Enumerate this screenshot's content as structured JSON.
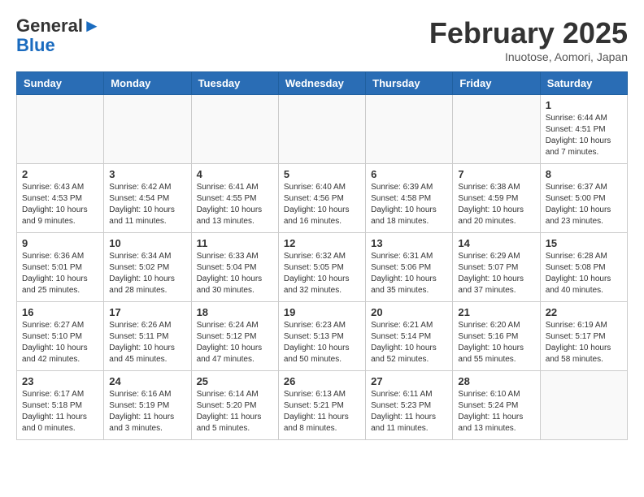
{
  "logo": {
    "general": "General",
    "blue": "Blue"
  },
  "title": "February 2025",
  "subtitle": "Inuotose, Aomori, Japan",
  "days": [
    "Sunday",
    "Monday",
    "Tuesday",
    "Wednesday",
    "Thursday",
    "Friday",
    "Saturday"
  ],
  "weeks": [
    [
      {
        "day": "",
        "info": ""
      },
      {
        "day": "",
        "info": ""
      },
      {
        "day": "",
        "info": ""
      },
      {
        "day": "",
        "info": ""
      },
      {
        "day": "",
        "info": ""
      },
      {
        "day": "",
        "info": ""
      },
      {
        "day": "1",
        "info": "Sunrise: 6:44 AM\nSunset: 4:51 PM\nDaylight: 10 hours\nand 7 minutes."
      }
    ],
    [
      {
        "day": "2",
        "info": "Sunrise: 6:43 AM\nSunset: 4:53 PM\nDaylight: 10 hours\nand 9 minutes."
      },
      {
        "day": "3",
        "info": "Sunrise: 6:42 AM\nSunset: 4:54 PM\nDaylight: 10 hours\nand 11 minutes."
      },
      {
        "day": "4",
        "info": "Sunrise: 6:41 AM\nSunset: 4:55 PM\nDaylight: 10 hours\nand 13 minutes."
      },
      {
        "day": "5",
        "info": "Sunrise: 6:40 AM\nSunset: 4:56 PM\nDaylight: 10 hours\nand 16 minutes."
      },
      {
        "day": "6",
        "info": "Sunrise: 6:39 AM\nSunset: 4:58 PM\nDaylight: 10 hours\nand 18 minutes."
      },
      {
        "day": "7",
        "info": "Sunrise: 6:38 AM\nSunset: 4:59 PM\nDaylight: 10 hours\nand 20 minutes."
      },
      {
        "day": "8",
        "info": "Sunrise: 6:37 AM\nSunset: 5:00 PM\nDaylight: 10 hours\nand 23 minutes."
      }
    ],
    [
      {
        "day": "9",
        "info": "Sunrise: 6:36 AM\nSunset: 5:01 PM\nDaylight: 10 hours\nand 25 minutes."
      },
      {
        "day": "10",
        "info": "Sunrise: 6:34 AM\nSunset: 5:02 PM\nDaylight: 10 hours\nand 28 minutes."
      },
      {
        "day": "11",
        "info": "Sunrise: 6:33 AM\nSunset: 5:04 PM\nDaylight: 10 hours\nand 30 minutes."
      },
      {
        "day": "12",
        "info": "Sunrise: 6:32 AM\nSunset: 5:05 PM\nDaylight: 10 hours\nand 32 minutes."
      },
      {
        "day": "13",
        "info": "Sunrise: 6:31 AM\nSunset: 5:06 PM\nDaylight: 10 hours\nand 35 minutes."
      },
      {
        "day": "14",
        "info": "Sunrise: 6:29 AM\nSunset: 5:07 PM\nDaylight: 10 hours\nand 37 minutes."
      },
      {
        "day": "15",
        "info": "Sunrise: 6:28 AM\nSunset: 5:08 PM\nDaylight: 10 hours\nand 40 minutes."
      }
    ],
    [
      {
        "day": "16",
        "info": "Sunrise: 6:27 AM\nSunset: 5:10 PM\nDaylight: 10 hours\nand 42 minutes."
      },
      {
        "day": "17",
        "info": "Sunrise: 6:26 AM\nSunset: 5:11 PM\nDaylight: 10 hours\nand 45 minutes."
      },
      {
        "day": "18",
        "info": "Sunrise: 6:24 AM\nSunset: 5:12 PM\nDaylight: 10 hours\nand 47 minutes."
      },
      {
        "day": "19",
        "info": "Sunrise: 6:23 AM\nSunset: 5:13 PM\nDaylight: 10 hours\nand 50 minutes."
      },
      {
        "day": "20",
        "info": "Sunrise: 6:21 AM\nSunset: 5:14 PM\nDaylight: 10 hours\nand 52 minutes."
      },
      {
        "day": "21",
        "info": "Sunrise: 6:20 AM\nSunset: 5:16 PM\nDaylight: 10 hours\nand 55 minutes."
      },
      {
        "day": "22",
        "info": "Sunrise: 6:19 AM\nSunset: 5:17 PM\nDaylight: 10 hours\nand 58 minutes."
      }
    ],
    [
      {
        "day": "23",
        "info": "Sunrise: 6:17 AM\nSunset: 5:18 PM\nDaylight: 11 hours\nand 0 minutes."
      },
      {
        "day": "24",
        "info": "Sunrise: 6:16 AM\nSunset: 5:19 PM\nDaylight: 11 hours\nand 3 minutes."
      },
      {
        "day": "25",
        "info": "Sunrise: 6:14 AM\nSunset: 5:20 PM\nDaylight: 11 hours\nand 5 minutes."
      },
      {
        "day": "26",
        "info": "Sunrise: 6:13 AM\nSunset: 5:21 PM\nDaylight: 11 hours\nand 8 minutes."
      },
      {
        "day": "27",
        "info": "Sunrise: 6:11 AM\nSunset: 5:23 PM\nDaylight: 11 hours\nand 11 minutes."
      },
      {
        "day": "28",
        "info": "Sunrise: 6:10 AM\nSunset: 5:24 PM\nDaylight: 11 hours\nand 13 minutes."
      },
      {
        "day": "",
        "info": ""
      }
    ]
  ]
}
